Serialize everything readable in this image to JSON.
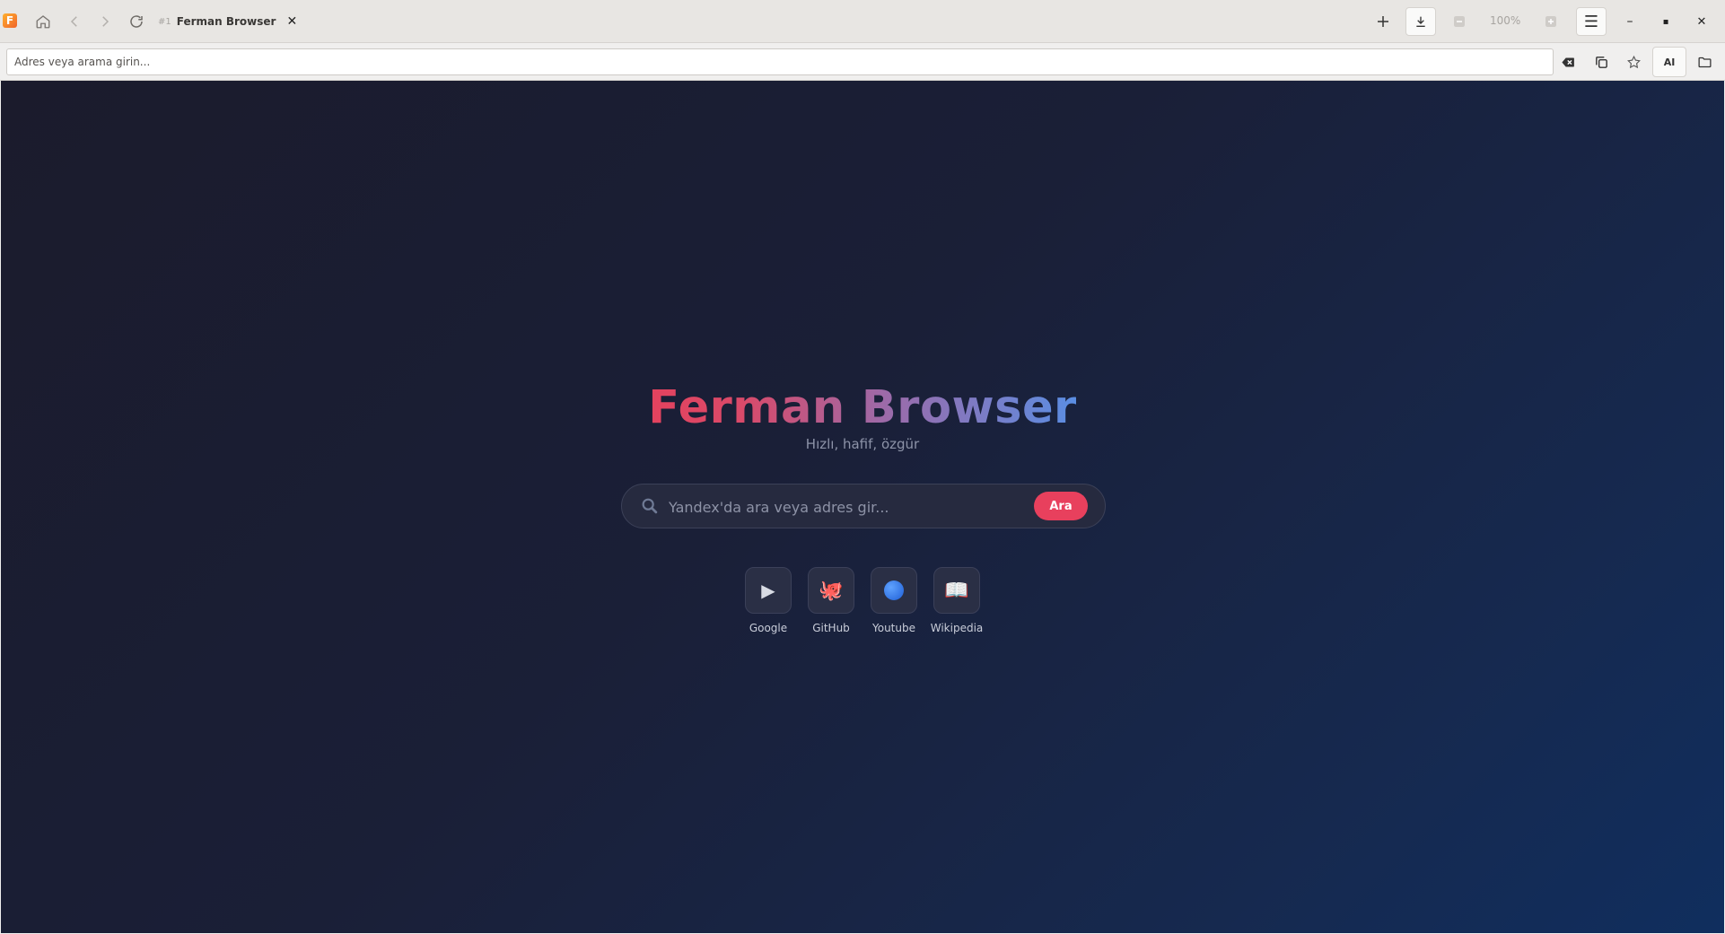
{
  "window": {
    "tab": {
      "index": "#1",
      "title": "Ferman Browser",
      "close_glyph": "✕"
    },
    "zoom_level": "100%",
    "menu_glyph": "☰",
    "window_controls": {
      "minimize": "–",
      "maximize": "▪",
      "close": "✕"
    }
  },
  "address_bar": {
    "placeholder": "Adres veya arama girin...",
    "value": "",
    "ai_label": "AI"
  },
  "page": {
    "title": "Ferman Browser",
    "subtitle": "Hızlı, hafif, özgür",
    "search": {
      "placeholder": "Yandex'da ara veya adres gir...",
      "button_label": "Ara"
    },
    "quick_links": [
      {
        "label": "Google",
        "icon": "▶",
        "icon_name": "play-icon"
      },
      {
        "label": "GitHub",
        "icon": "🐙",
        "icon_name": "octopus-icon"
      },
      {
        "label": "Youtube",
        "icon": "🔵",
        "icon_name": "blue-circle-icon"
      },
      {
        "label": "Wikipedia",
        "icon": "📖",
        "icon_name": "book-icon"
      }
    ]
  },
  "colors": {
    "accent": "#e8405d",
    "title_gradient_start": "#e4425e",
    "title_gradient_end": "#5a8ee3",
    "background_start": "#1b1b2c",
    "background_end": "#102e5e"
  }
}
